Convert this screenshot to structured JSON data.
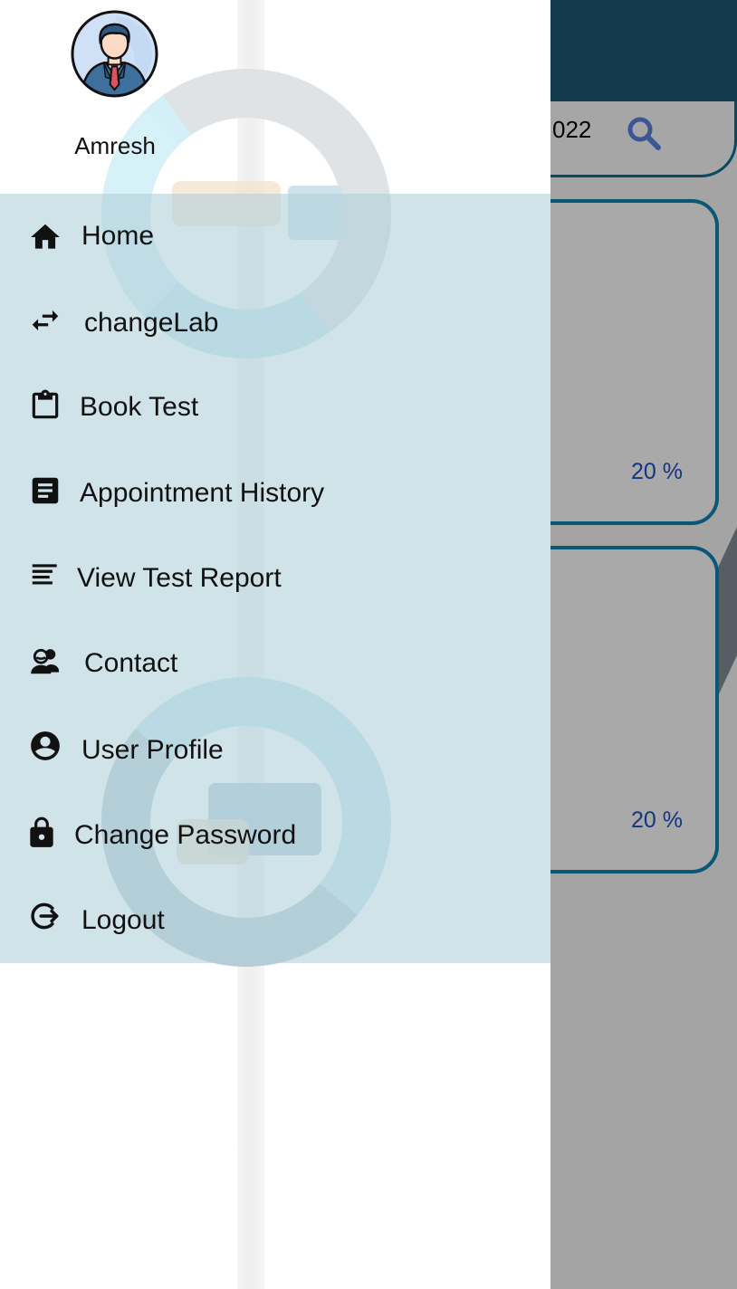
{
  "app": {
    "search": {
      "value_partial": "022",
      "icon": "search-icon"
    },
    "cards": [
      {
        "percent_label": "20 %"
      },
      {
        "percent_label": "20 %"
      }
    ],
    "colors": {
      "header": "#1c5474",
      "card_border": "#0f82ad",
      "percent_text": "#1e4fbf"
    }
  },
  "drawer": {
    "user": {
      "name": "Amresh",
      "avatar": "businessman-avatar"
    },
    "menu_background": "#cfe1e6",
    "items": [
      {
        "label": "Home",
        "icon": "home-icon"
      },
      {
        "label": "changeLab",
        "icon": "swap-arrows-icon"
      },
      {
        "label": "Book Test",
        "icon": "clipboard-icon"
      },
      {
        "label": "Appointment History",
        "icon": "document-list-icon"
      },
      {
        "label": "View Test Report",
        "icon": "notes-lines-icon"
      },
      {
        "label": "Contact",
        "icon": "people-icon"
      },
      {
        "label": "User Profile",
        "icon": "account-circle-icon"
      },
      {
        "label": "Change Password",
        "icon": "lock-icon"
      },
      {
        "label": "Logout",
        "icon": "logout-icon"
      }
    ]
  }
}
